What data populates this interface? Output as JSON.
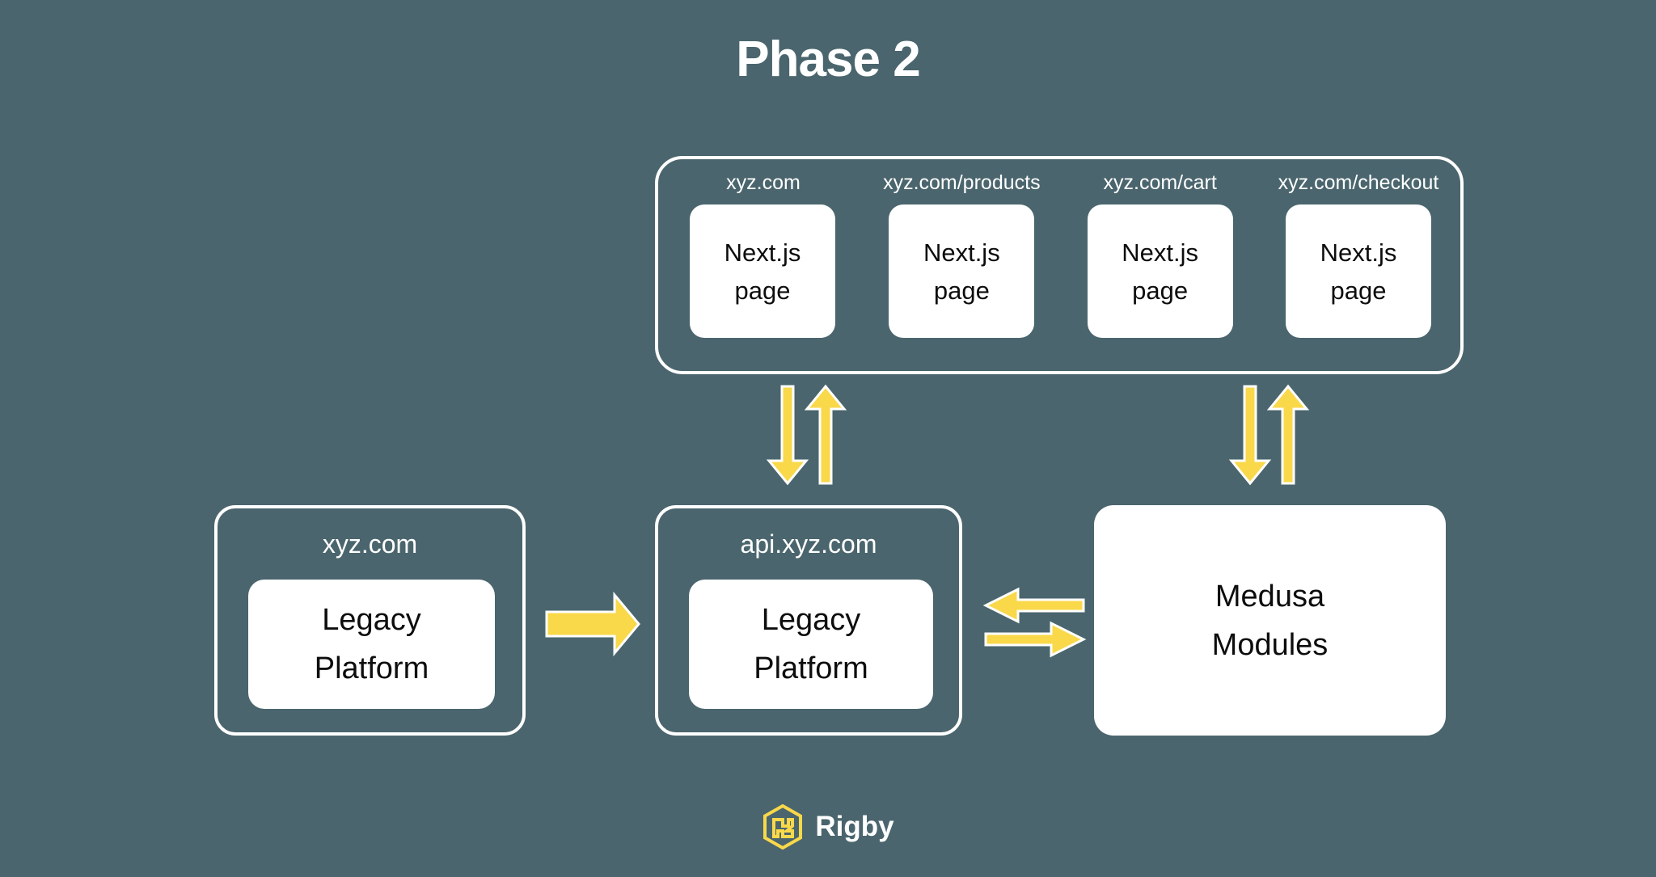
{
  "diagram": {
    "title": "Phase 2",
    "background_color": "#4a656d",
    "accent_color": "#f9d84a",
    "border_color": "#ffffff",
    "card_color": "#ffffff",
    "card_text_color": "#0d0d0d"
  },
  "pages_panel": {
    "pages": [
      {
        "url": "xyz.com",
        "line1": "Next.js",
        "line2": "page"
      },
      {
        "url": "xyz.com/products",
        "line1": "Next.js",
        "line2": "page"
      },
      {
        "url": "xyz.com/cart",
        "line1": "Next.js",
        "line2": "page"
      },
      {
        "url": "xyz.com/checkout",
        "line1": "Next.js",
        "line2": "page"
      }
    ]
  },
  "bottom_row": {
    "legacy_store": {
      "label": "xyz.com",
      "card_line1": "Legacy",
      "card_line2": "Platform"
    },
    "api": {
      "label": "api.xyz.com",
      "card_line1": "Legacy",
      "card_line2": "Platform"
    },
    "medusa": {
      "card_line1": "Medusa",
      "card_line2": "Modules"
    }
  },
  "connections": [
    {
      "name": "pages-to-api-down",
      "direction": "down",
      "from": "Next.js pages panel",
      "to": "api.xyz.com"
    },
    {
      "name": "api-to-pages-up",
      "direction": "up",
      "from": "api.xyz.com",
      "to": "Next.js pages panel"
    },
    {
      "name": "pages-to-medusa-down",
      "direction": "down",
      "from": "Next.js pages panel",
      "to": "Medusa Modules"
    },
    {
      "name": "medusa-to-pages-up",
      "direction": "up",
      "from": "Medusa Modules",
      "to": "Next.js pages panel"
    },
    {
      "name": "legacy-to-api-right",
      "direction": "right",
      "from": "xyz.com Legacy Platform",
      "to": "api.xyz.com Legacy Platform"
    },
    {
      "name": "medusa-to-api-left",
      "direction": "left",
      "from": "Medusa Modules",
      "to": "api.xyz.com"
    },
    {
      "name": "api-to-medusa-right",
      "direction": "right",
      "from": "api.xyz.com",
      "to": "Medusa Modules"
    }
  ],
  "footer": {
    "logo_text": "Rigby",
    "logo_icon": "rigby-hexagon-logo-icon"
  }
}
